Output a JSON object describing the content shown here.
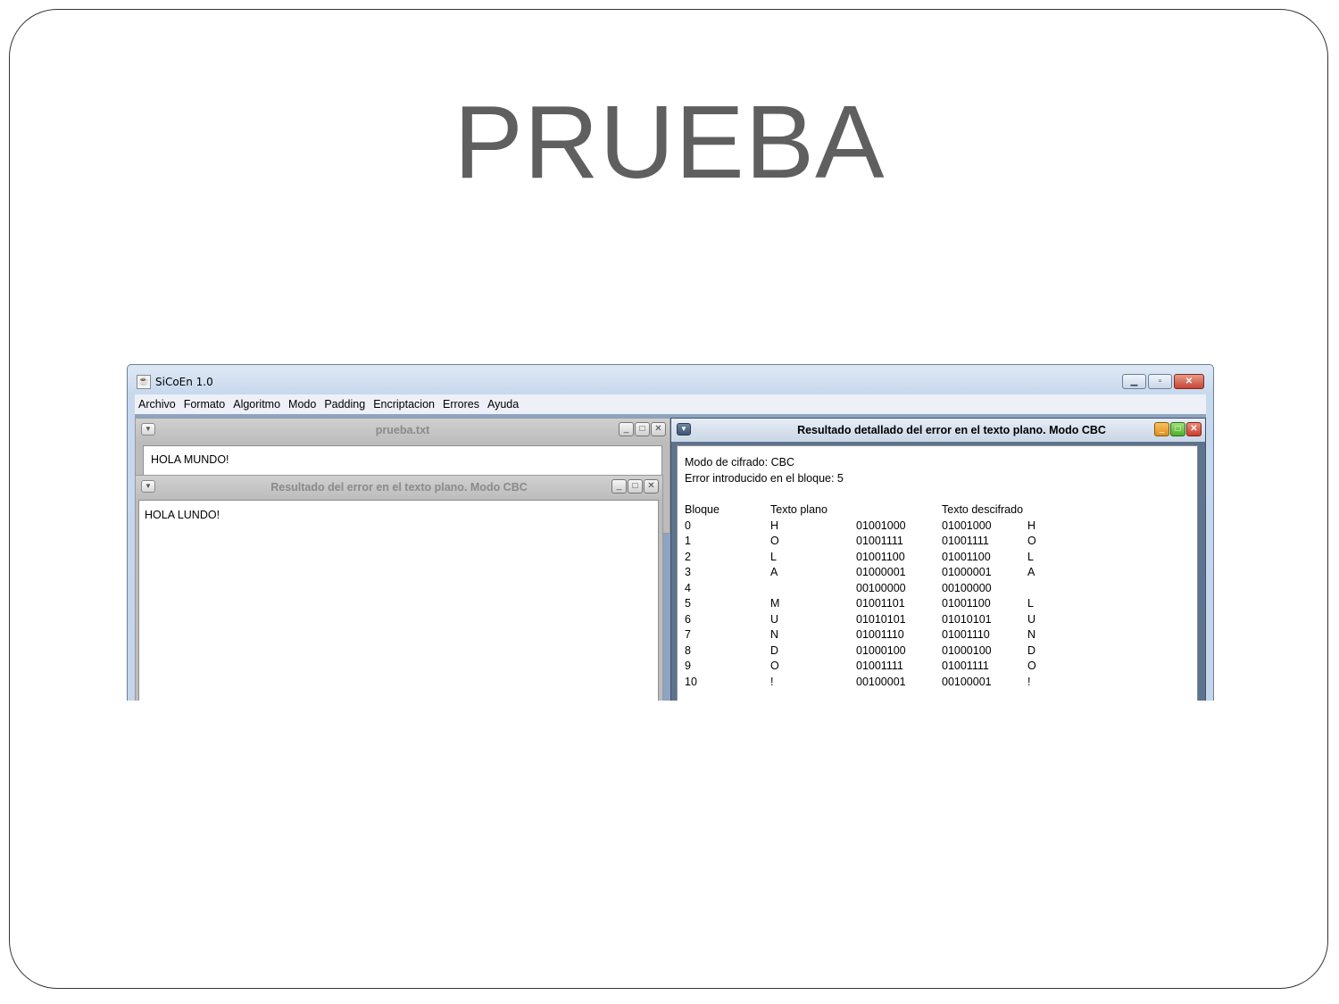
{
  "slide": {
    "title": "PRUEBA"
  },
  "app": {
    "title": "SiCoEn 1.0",
    "menu": [
      "Archivo",
      "Formato",
      "Algoritmo",
      "Modo",
      "Padding",
      "Encriptacion",
      "Errores",
      "Ayuda"
    ]
  },
  "file_window": {
    "title": "prueba.txt",
    "content": "HOLA MUNDO!"
  },
  "result_window": {
    "title": "Resultado del error en el texto plano. Modo CBC",
    "content": "HOLA LUNDO!"
  },
  "detail_window": {
    "title": "Resultado detallado del error en el texto plano. Modo CBC",
    "mode_line": "Modo de cifrado: CBC",
    "error_line": "Error introducido en el bloque: 5",
    "headers": [
      "Bloque",
      "Texto plano",
      "",
      "Texto descifrado",
      ""
    ],
    "rows": [
      [
        "0",
        "H",
        "01001000",
        "01001000",
        "H"
      ],
      [
        "1",
        "O",
        "01001111",
        "01001111",
        "O"
      ],
      [
        "2",
        "L",
        "01001100",
        "01001100",
        "L"
      ],
      [
        "3",
        "A",
        "01000001",
        "01000001",
        "A"
      ],
      [
        "4",
        "",
        "00100000",
        "00100000",
        ""
      ],
      [
        "5",
        "M",
        "01001101",
        "01001100",
        "L"
      ],
      [
        "6",
        "U",
        "01010101",
        "01010101",
        "U"
      ],
      [
        "7",
        "N",
        "01001110",
        "01001110",
        "N"
      ],
      [
        "8",
        "D",
        "01000100",
        "01000100",
        "D"
      ],
      [
        "9",
        "O",
        "01001111",
        "01001111",
        "O"
      ],
      [
        "10",
        "!",
        "00100001",
        "00100001",
        "!"
      ]
    ]
  }
}
